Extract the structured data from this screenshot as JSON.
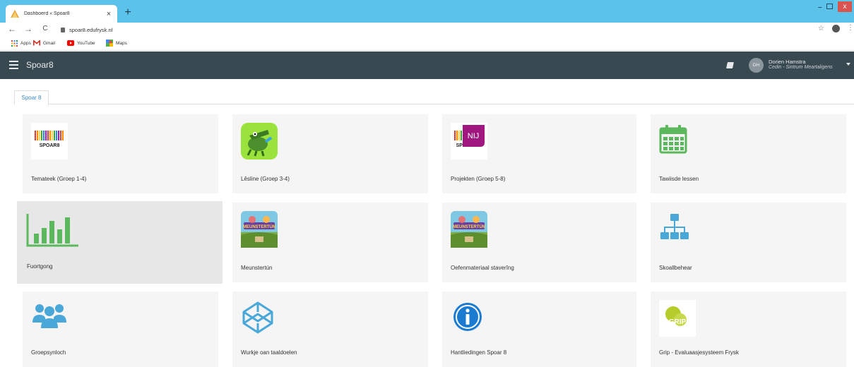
{
  "browser": {
    "tab_title": "Dashboerd « Spoar8",
    "close_glyph": "×",
    "newtab_glyph": "+",
    "back_glyph": "←",
    "forward_glyph": "→",
    "reload_glyph": "C",
    "url": "spoar8.edufrysk.nl",
    "star_glyph": "☆",
    "more_glyph": "⋮",
    "minimize_glyph": "–",
    "close_window_glyph": "x",
    "bookmarks": [
      {
        "label": "Apps",
        "icon": "apps-grid-icon"
      },
      {
        "label": "Gmail",
        "icon": "gmail-icon"
      },
      {
        "label": "YouTube",
        "icon": "youtube-icon"
      },
      {
        "label": "Maps",
        "icon": "maps-icon"
      }
    ]
  },
  "header": {
    "title": "Spoar8",
    "user_initials": "DH",
    "user_name": "Dorien Hamstra",
    "user_org": "Cedin - Sintrum Meartaligens"
  },
  "tabs": [
    {
      "label": "Spoar 8",
      "active": true
    }
  ],
  "tiles": [
    {
      "label": "Temateek (Groep 1-4)",
      "icon": "spoar8-logo-icon",
      "active": false
    },
    {
      "label": "Lêsline (Groep 3-4)",
      "icon": "crocodile-icon",
      "active": false
    },
    {
      "label": "Projekten (Groep 5-8)",
      "icon": "spoar8-nij-logo-icon",
      "active": false
    },
    {
      "label": "Tawiisde lessen",
      "icon": "calendar-icon",
      "active": false
    },
    {
      "label": "Fuortgong",
      "icon": "bar-chart-icon",
      "active": true
    },
    {
      "label": "Meunstertún",
      "icon": "meunstertun-game-icon",
      "active": false
    },
    {
      "label": "Oefenmateriaal staverîng",
      "icon": "meunstertun-game-icon",
      "active": false
    },
    {
      "label": "Skoallbehear",
      "icon": "sitemap-icon",
      "active": false
    },
    {
      "label": "Groepsynloch",
      "icon": "users-group-icon",
      "active": false
    },
    {
      "label": "Wurkje oan taaldoelen",
      "icon": "codepen-cube-icon",
      "active": false
    },
    {
      "label": "Hantliedingen Spoar 8",
      "icon": "info-circle-icon",
      "active": false
    },
    {
      "label": "Grip - Evaluaasjesysteem Frysk",
      "icon": "grip-logo-icon",
      "active": false
    }
  ],
  "logos": {
    "spoar8": "SPOAR8",
    "nij": "NIJ",
    "meunstertun": "MEUNSTERTÚN",
    "grip": "GRIP"
  },
  "colors": {
    "browser_frame": "#5bc3ea",
    "app_header": "#394951",
    "tile_bg": "#f5f5f5",
    "tile_active_bg": "#e7e7e7",
    "green": "#5cb85c",
    "blue": "#4aa8d8",
    "tab_link": "#3a8bc1"
  }
}
